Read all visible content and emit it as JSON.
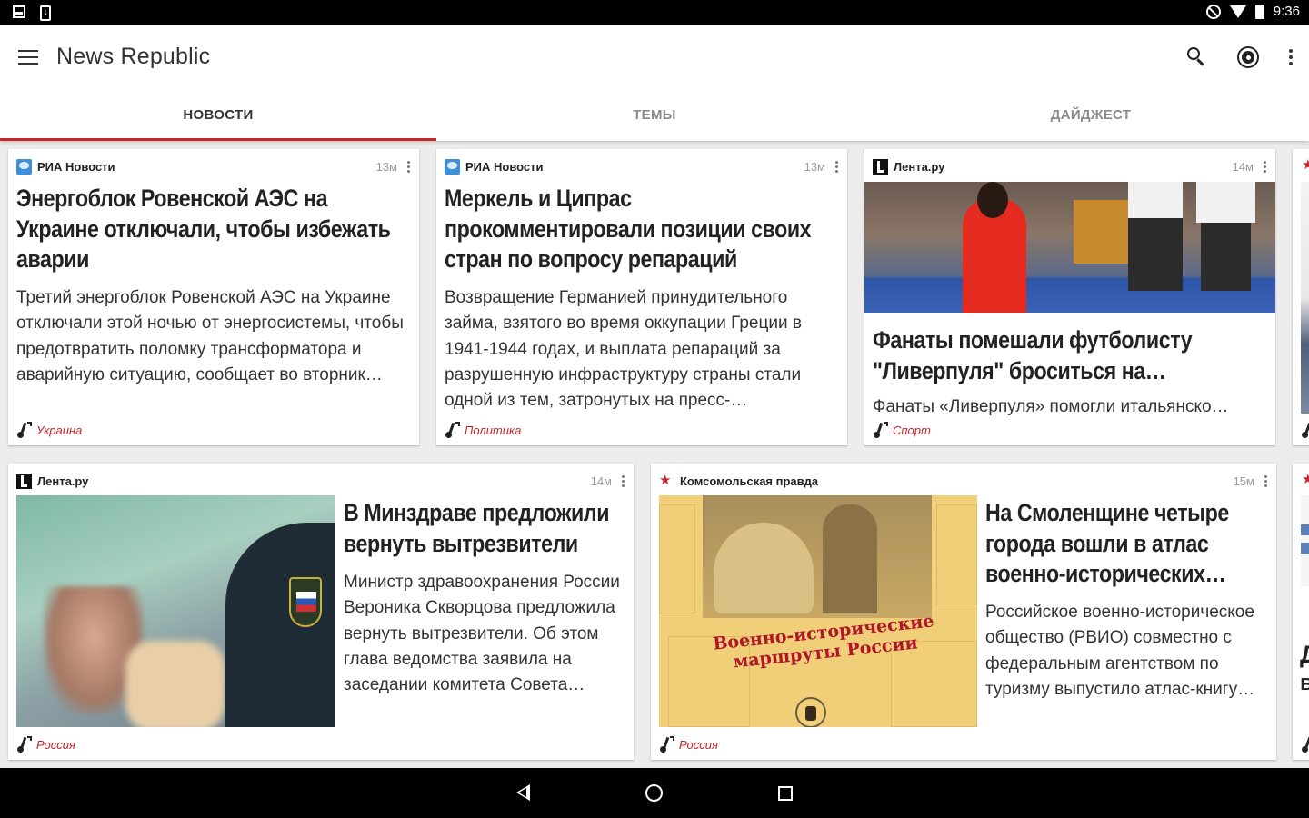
{
  "status_bar": {
    "time": "9:36",
    "left_icons": [
      "image-icon",
      "download-icon"
    ],
    "right_icons": [
      "do-not-disturb-icon",
      "wifi-icon",
      "battery-icon"
    ]
  },
  "app_bar": {
    "title": "News Republic",
    "actions": [
      "search-icon",
      "radar-icon",
      "more-vert-icon"
    ]
  },
  "tabs": [
    {
      "label": "НОВОСТИ",
      "active": true
    },
    {
      "label": "ТЕМЫ",
      "active": false
    },
    {
      "label": "ДАЙДЖЕСТ",
      "active": false
    }
  ],
  "accent_color": "#c8262b",
  "articles": [
    {
      "source": "РИА Новости",
      "time": "13м",
      "title": "Энергоблок Ровенской АЭС на Украине отключали, чтобы избежать аварии",
      "description": "Третий энергоблок Ровенской АЭС на Украине отключали этой ночью от энергосистемы, чтобы предотвратить поломку трансформатора и аварийную ситуацию, сообщает во вторник…",
      "category": "Украина"
    },
    {
      "source": "РИА Новости",
      "time": "13м",
      "title": "Меркель и Ципрас прокомментировали позиции своих стран по вопросу репараций",
      "description": "Возвращение Германией принудительного займа, взятого во время оккупации Греции в 1941-1944 годах, и выплата репараций за разрушенную инфраструктуру страны стали одной из тем, затронутых на пресс-…",
      "category": "Политика"
    },
    {
      "source": "Лента.ру",
      "time": "14м",
      "title": "Фанаты помешали футболисту \"Ливерпуля\" броситься на…",
      "description": "Фанаты «Ливерпуля» помогли итальянско…",
      "category": "Спорт"
    },
    {
      "source": "Лента.ру",
      "time": "14м",
      "title": "В Минздраве предложили вернуть вытрезвители",
      "description": "Министр здравоохранения России Вероника Скворцова предложила вернуть вытрезвители. Об этом глава ведомства заявила на заседании комитета Совета…",
      "category": "Россия"
    },
    {
      "source": "Комсомольская правда",
      "time": "15м",
      "title": "На Смоленщине четыре города вошли в атлас военно-исторических…",
      "description": "Российское военно-историческое общество (РВИО) совместно с федеральным агентством по туризму выпустило атлас-книгу…",
      "category": "Россия",
      "image_caption": "Военно-исторические маршруты России"
    }
  ],
  "peek_cards": [
    {
      "title_fragment": "Д\nВ",
      "desc_fragment": "\"|"
    }
  ],
  "nav_bar": [
    "back-icon",
    "home-icon",
    "recents-icon"
  ]
}
